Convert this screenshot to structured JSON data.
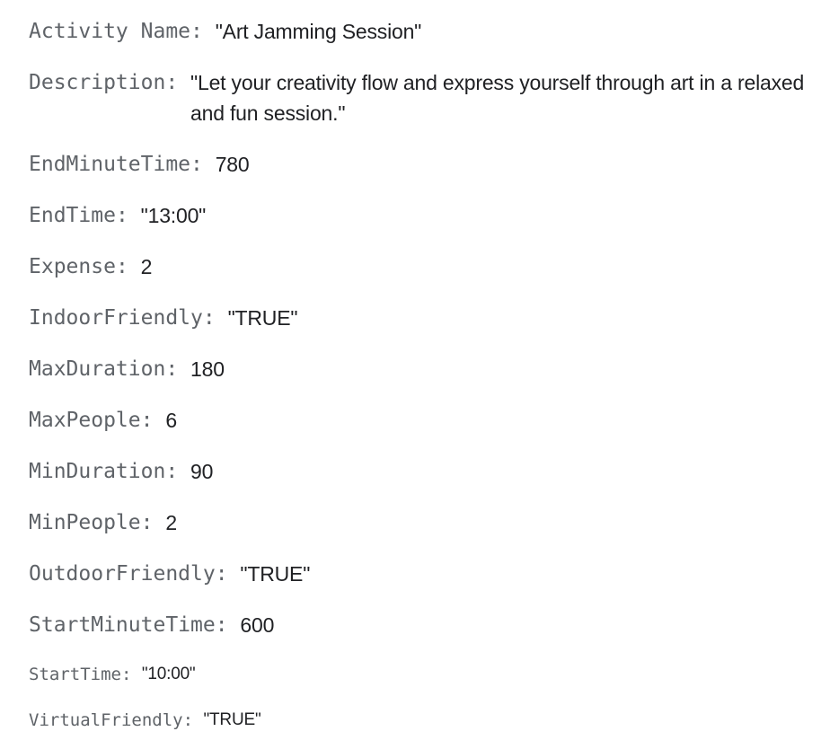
{
  "fields": [
    {
      "key": "Activity Name",
      "value": "\"Art Jamming Session\""
    },
    {
      "key": "Description",
      "value": "\"Let your creativity flow and express yourself through art in a relaxed and fun session.\""
    },
    {
      "key": "EndMinuteTime",
      "value": "780"
    },
    {
      "key": "EndTime",
      "value": "\"13:00\""
    },
    {
      "key": "Expense",
      "value": "2"
    },
    {
      "key": "IndoorFriendly",
      "value": "\"TRUE\""
    },
    {
      "key": "MaxDuration",
      "value": "180"
    },
    {
      "key": "MaxPeople",
      "value": "6"
    },
    {
      "key": "MinDuration",
      "value": "90"
    },
    {
      "key": "MinPeople",
      "value": "2"
    },
    {
      "key": "OutdoorFriendly",
      "value": "\"TRUE\""
    },
    {
      "key": "StartMinuteTime",
      "value": "600"
    },
    {
      "key": "StartTime",
      "value": "\"10:00\""
    },
    {
      "key": "VirtualFriendly",
      "value": "\"TRUE\""
    }
  ],
  "separator": ": "
}
